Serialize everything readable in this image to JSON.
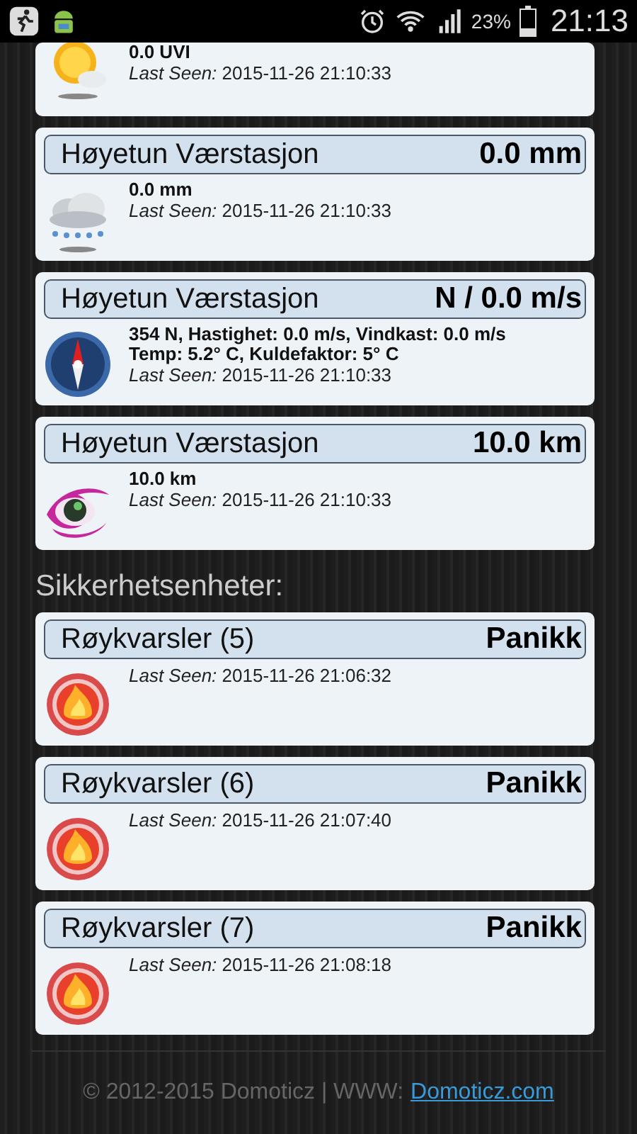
{
  "status_bar": {
    "battery_percent": "23%",
    "time": "21:13"
  },
  "weather_devices": [
    {
      "kind": "sun",
      "details": [
        "0.0 UVI"
      ],
      "last_seen": "*Last Seen:* 2015-11-26 21:10:33"
    },
    {
      "kind": "rain",
      "name": "Høyetun Værstasjon",
      "value": "0.0 mm",
      "details": [
        "0.0 mm"
      ],
      "last_seen": "*Last Seen:* 2015-11-26 21:10:33"
    },
    {
      "kind": "compass",
      "name": "Høyetun Værstasjon",
      "value": "N / 0.0 m/s",
      "details": [
        "354 N, Hastighet: 0.0 m/s, Vindkast: 0.0 m/s",
        "Temp: 5.2° C, Kuldefaktor: 5° C"
      ],
      "last_seen": "*Last Seen:* 2015-11-26 21:10:33"
    },
    {
      "kind": "eye",
      "name": "Høyetun Værstasjon",
      "value": "10.0 km",
      "details": [
        "10.0 km"
      ],
      "last_seen": "*Last Seen:* 2015-11-26 21:10:33"
    }
  ],
  "security_section": {
    "title": "Sikkerhetsenheter:"
  },
  "security_devices": [
    {
      "kind": "fire",
      "name": "Røykvarsler (5)",
      "value": "Panikk",
      "last_seen": "*Last Seen:* 2015-11-26 21:06:32"
    },
    {
      "kind": "fire",
      "name": "Røykvarsler (6)",
      "value": "Panikk",
      "last_seen": "*Last Seen:* 2015-11-26 21:07:40"
    },
    {
      "kind": "fire",
      "name": "Røykvarsler (7)",
      "value": "Panikk",
      "last_seen": "*Last Seen:* 2015-11-26 21:08:18"
    }
  ],
  "footer": {
    "text": "© 2012-2015 Domoticz | WWW:",
    "link": "Domoticz.com"
  }
}
